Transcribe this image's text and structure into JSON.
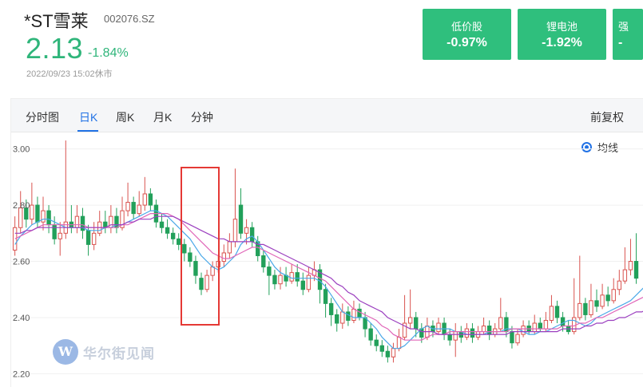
{
  "stock": {
    "name": "*ST雪莱",
    "code": "002076.SZ",
    "price": "2.13",
    "change_pct": "-1.84%",
    "timestamp": "2022/09/23 15:02休市"
  },
  "sectors": [
    {
      "name": "低价股",
      "change": "-0.97%"
    },
    {
      "name": "锂电池",
      "change": "-1.92%"
    },
    {
      "name": "强",
      "change": "-"
    }
  ],
  "tabs": [
    "分时图",
    "日K",
    "周K",
    "月K",
    "分钟"
  ],
  "active_tab": "日K",
  "adjust_label": "前复权",
  "ma_toggle_label": "均线",
  "watermark_text": "华尔街见闻",
  "watermark_logo_letter": "W",
  "colors": {
    "up": "#d9534f",
    "down": "#22a05a",
    "accent": "#2172e5",
    "card": "#2fbf7d"
  },
  "chart_data": {
    "type": "candlestick",
    "y_ticks": [
      "3.00",
      "2.80",
      "2.60",
      "2.40",
      "2.20"
    ],
    "ylim": [
      2.17,
      3.05
    ],
    "x_span": [
      0,
      130
    ],
    "candles": [
      {
        "o": 2.64,
        "c": 2.72,
        "h": 2.76,
        "l": 2.62
      },
      {
        "o": 2.72,
        "c": 2.79,
        "h": 2.85,
        "l": 2.7
      },
      {
        "o": 2.79,
        "c": 2.75,
        "h": 2.82,
        "l": 2.72
      },
      {
        "o": 2.75,
        "c": 2.8,
        "h": 2.88,
        "l": 2.73
      },
      {
        "o": 2.8,
        "c": 2.74,
        "h": 2.83,
        "l": 2.72
      },
      {
        "o": 2.74,
        "c": 2.78,
        "h": 2.83,
        "l": 2.71
      },
      {
        "o": 2.78,
        "c": 2.73,
        "h": 2.8,
        "l": 2.7
      },
      {
        "o": 2.73,
        "c": 2.68,
        "h": 2.76,
        "l": 2.66
      },
      {
        "o": 2.68,
        "c": 2.7,
        "h": 2.74,
        "l": 2.62
      },
      {
        "o": 2.7,
        "c": 2.74,
        "h": 3.03,
        "l": 2.68
      },
      {
        "o": 2.74,
        "c": 2.72,
        "h": 2.8,
        "l": 2.7
      },
      {
        "o": 2.72,
        "c": 2.76,
        "h": 2.8,
        "l": 2.7
      },
      {
        "o": 2.76,
        "c": 2.71,
        "h": 2.79,
        "l": 2.68
      },
      {
        "o": 2.71,
        "c": 2.66,
        "h": 2.73,
        "l": 2.62
      },
      {
        "o": 2.66,
        "c": 2.7,
        "h": 2.74,
        "l": 2.64
      },
      {
        "o": 2.7,
        "c": 2.74,
        "h": 2.78,
        "l": 2.69
      },
      {
        "o": 2.74,
        "c": 2.72,
        "h": 2.78,
        "l": 2.7
      },
      {
        "o": 2.72,
        "c": 2.76,
        "h": 2.8,
        "l": 2.7
      },
      {
        "o": 2.76,
        "c": 2.72,
        "h": 2.79,
        "l": 2.7
      },
      {
        "o": 2.72,
        "c": 2.78,
        "h": 2.83,
        "l": 2.71
      },
      {
        "o": 2.78,
        "c": 2.81,
        "h": 2.88,
        "l": 2.76
      },
      {
        "o": 2.81,
        "c": 2.77,
        "h": 2.83,
        "l": 2.75
      },
      {
        "o": 2.77,
        "c": 2.8,
        "h": 2.85,
        "l": 2.76
      },
      {
        "o": 2.8,
        "c": 2.84,
        "h": 2.9,
        "l": 2.78
      },
      {
        "o": 2.84,
        "c": 2.8,
        "h": 2.86,
        "l": 2.78
      },
      {
        "o": 2.8,
        "c": 2.74,
        "h": 2.82,
        "l": 2.72
      },
      {
        "o": 2.74,
        "c": 2.72,
        "h": 2.77,
        "l": 2.7
      },
      {
        "o": 2.72,
        "c": 2.7,
        "h": 2.75,
        "l": 2.68
      },
      {
        "o": 2.7,
        "c": 2.68,
        "h": 2.72,
        "l": 2.66
      },
      {
        "o": 2.68,
        "c": 2.66,
        "h": 2.7,
        "l": 2.64
      },
      {
        "o": 2.66,
        "c": 2.63,
        "h": 2.68,
        "l": 2.6
      },
      {
        "o": 2.63,
        "c": 2.6,
        "h": 2.65,
        "l": 2.58
      },
      {
        "o": 2.6,
        "c": 2.55,
        "h": 2.62,
        "l": 2.52
      },
      {
        "o": 2.54,
        "c": 2.5,
        "h": 2.56,
        "l": 2.48
      },
      {
        "o": 2.5,
        "c": 2.55,
        "h": 2.57,
        "l": 2.49
      },
      {
        "o": 2.55,
        "c": 2.58,
        "h": 2.6,
        "l": 2.53
      },
      {
        "o": 2.58,
        "c": 2.6,
        "h": 2.62,
        "l": 2.56
      },
      {
        "o": 2.6,
        "c": 2.63,
        "h": 2.66,
        "l": 2.58
      },
      {
        "o": 2.63,
        "c": 2.67,
        "h": 2.7,
        "l": 2.61
      },
      {
        "o": 2.67,
        "c": 2.75,
        "h": 2.93,
        "l": 2.65
      },
      {
        "o": 2.8,
        "c": 2.7,
        "h": 2.86,
        "l": 2.68
      },
      {
        "o": 2.7,
        "c": 2.72,
        "h": 2.75,
        "l": 2.66
      },
      {
        "o": 2.72,
        "c": 2.67,
        "h": 2.74,
        "l": 2.65
      },
      {
        "o": 2.67,
        "c": 2.62,
        "h": 2.69,
        "l": 2.6
      },
      {
        "o": 2.62,
        "c": 2.58,
        "h": 2.64,
        "l": 2.56
      },
      {
        "o": 2.58,
        "c": 2.55,
        "h": 2.6,
        "l": 2.48
      },
      {
        "o": 2.55,
        "c": 2.52,
        "h": 2.57,
        "l": 2.5
      },
      {
        "o": 2.52,
        "c": 2.55,
        "h": 2.58,
        "l": 2.5
      },
      {
        "o": 2.55,
        "c": 2.53,
        "h": 2.58,
        "l": 2.51
      },
      {
        "o": 2.53,
        "c": 2.56,
        "h": 2.59,
        "l": 2.52
      },
      {
        "o": 2.56,
        "c": 2.53,
        "h": 2.59,
        "l": 2.51
      },
      {
        "o": 2.53,
        "c": 2.5,
        "h": 2.56,
        "l": 2.48
      },
      {
        "o": 2.5,
        "c": 2.55,
        "h": 2.58,
        "l": 2.49
      },
      {
        "o": 2.55,
        "c": 2.57,
        "h": 2.6,
        "l": 2.53
      },
      {
        "o": 2.57,
        "c": 2.5,
        "h": 2.59,
        "l": 2.45
      },
      {
        "o": 2.5,
        "c": 2.45,
        "h": 2.52,
        "l": 2.4
      },
      {
        "o": 2.45,
        "c": 2.41,
        "h": 2.47,
        "l": 2.37
      },
      {
        "o": 2.41,
        "c": 2.38,
        "h": 2.43,
        "l": 2.35
      },
      {
        "o": 2.38,
        "c": 2.42,
        "h": 2.45,
        "l": 2.36
      },
      {
        "o": 2.42,
        "c": 2.39,
        "h": 2.44,
        "l": 2.37
      },
      {
        "o": 2.39,
        "c": 2.43,
        "h": 2.46,
        "l": 2.38
      },
      {
        "o": 2.43,
        "c": 2.4,
        "h": 2.45,
        "l": 2.39
      },
      {
        "o": 2.4,
        "c": 2.36,
        "h": 2.42,
        "l": 2.33
      },
      {
        "o": 2.36,
        "c": 2.32,
        "h": 2.38,
        "l": 2.3
      },
      {
        "o": 2.32,
        "c": 2.3,
        "h": 2.34,
        "l": 2.28
      },
      {
        "o": 2.3,
        "c": 2.28,
        "h": 2.32,
        "l": 2.26
      },
      {
        "o": 2.28,
        "c": 2.26,
        "h": 2.3,
        "l": 2.24
      },
      {
        "o": 2.26,
        "c": 2.29,
        "h": 2.31,
        "l": 2.24
      },
      {
        "o": 2.29,
        "c": 2.33,
        "h": 2.36,
        "l": 2.28
      },
      {
        "o": 2.33,
        "c": 2.38,
        "h": 2.48,
        "l": 2.32
      },
      {
        "o": 2.38,
        "c": 2.4,
        "h": 2.5,
        "l": 2.36
      },
      {
        "o": 2.4,
        "c": 2.36,
        "h": 2.42,
        "l": 2.33
      },
      {
        "o": 2.36,
        "c": 2.33,
        "h": 2.38,
        "l": 2.31
      },
      {
        "o": 2.33,
        "c": 2.37,
        "h": 2.4,
        "l": 2.32
      },
      {
        "o": 2.37,
        "c": 2.35,
        "h": 2.39,
        "l": 2.33
      },
      {
        "o": 2.35,
        "c": 2.38,
        "h": 2.4,
        "l": 2.34
      },
      {
        "o": 2.38,
        "c": 2.34,
        "h": 2.4,
        "l": 2.32
      },
      {
        "o": 2.34,
        "c": 2.32,
        "h": 2.36,
        "l": 2.3
      },
      {
        "o": 2.32,
        "c": 2.35,
        "h": 2.38,
        "l": 2.26
      },
      {
        "o": 2.35,
        "c": 2.33,
        "h": 2.37,
        "l": 2.31
      },
      {
        "o": 2.33,
        "c": 2.36,
        "h": 2.38,
        "l": 2.32
      },
      {
        "o": 2.36,
        "c": 2.33,
        "h": 2.38,
        "l": 2.31
      },
      {
        "o": 2.33,
        "c": 2.35,
        "h": 2.37,
        "l": 2.32
      },
      {
        "o": 2.35,
        "c": 2.37,
        "h": 2.4,
        "l": 2.34
      },
      {
        "o": 2.37,
        "c": 2.34,
        "h": 2.39,
        "l": 2.32
      },
      {
        "o": 2.34,
        "c": 2.36,
        "h": 2.38,
        "l": 2.33
      },
      {
        "o": 2.36,
        "c": 2.4,
        "h": 2.47,
        "l": 2.35
      },
      {
        "o": 2.4,
        "c": 2.35,
        "h": 2.42,
        "l": 2.33
      },
      {
        "o": 2.35,
        "c": 2.31,
        "h": 2.37,
        "l": 2.29
      },
      {
        "o": 2.31,
        "c": 2.34,
        "h": 2.36,
        "l": 2.3
      },
      {
        "o": 2.34,
        "c": 2.37,
        "h": 2.39,
        "l": 2.33
      },
      {
        "o": 2.37,
        "c": 2.35,
        "h": 2.39,
        "l": 2.34
      },
      {
        "o": 2.35,
        "c": 2.38,
        "h": 2.41,
        "l": 2.34
      },
      {
        "o": 2.38,
        "c": 2.36,
        "h": 2.4,
        "l": 2.35
      },
      {
        "o": 2.36,
        "c": 2.39,
        "h": 2.42,
        "l": 2.35
      },
      {
        "o": 2.39,
        "c": 2.44,
        "h": 2.48,
        "l": 2.38
      },
      {
        "o": 2.44,
        "c": 2.4,
        "h": 2.46,
        "l": 2.38
      },
      {
        "o": 2.4,
        "c": 2.37,
        "h": 2.42,
        "l": 2.35
      },
      {
        "o": 2.37,
        "c": 2.35,
        "h": 2.39,
        "l": 2.34
      },
      {
        "o": 2.35,
        "c": 2.4,
        "h": 2.54,
        "l": 2.34
      },
      {
        "o": 2.4,
        "c": 2.45,
        "h": 2.62,
        "l": 2.39
      },
      {
        "o": 2.45,
        "c": 2.41,
        "h": 2.47,
        "l": 2.39
      },
      {
        "o": 2.41,
        "c": 2.46,
        "h": 2.52,
        "l": 2.4
      },
      {
        "o": 2.46,
        "c": 2.44,
        "h": 2.5,
        "l": 2.42
      },
      {
        "o": 2.44,
        "c": 2.48,
        "h": 2.52,
        "l": 2.43
      },
      {
        "o": 2.48,
        "c": 2.46,
        "h": 2.51,
        "l": 2.44
      },
      {
        "o": 2.46,
        "c": 2.5,
        "h": 2.54,
        "l": 2.45
      },
      {
        "o": 2.5,
        "c": 2.53,
        "h": 2.57,
        "l": 2.48
      },
      {
        "o": 2.53,
        "c": 2.57,
        "h": 2.65,
        "l": 2.52
      },
      {
        "o": 2.57,
        "c": 2.6,
        "h": 2.68,
        "l": 2.55
      },
      {
        "o": 2.6,
        "c": 2.54,
        "h": 2.7,
        "l": 2.52
      }
    ],
    "ma_lines": [
      {
        "color": "#4aa8e8",
        "values": [
          2.66,
          2.69,
          2.71,
          2.73,
          2.74,
          2.75,
          2.75,
          2.74,
          2.73,
          2.72,
          2.72,
          2.72,
          2.72,
          2.71,
          2.71,
          2.71,
          2.72,
          2.72,
          2.73,
          2.73,
          2.74,
          2.75,
          2.76,
          2.77,
          2.78,
          2.78,
          2.77,
          2.76,
          2.74,
          2.72,
          2.7,
          2.68,
          2.65,
          2.62,
          2.6,
          2.58,
          2.57,
          2.58,
          2.6,
          2.62,
          2.66,
          2.68,
          2.69,
          2.67,
          2.64,
          2.61,
          2.58,
          2.56,
          2.55,
          2.54,
          2.54,
          2.54,
          2.54,
          2.54,
          2.53,
          2.51,
          2.48,
          2.45,
          2.42,
          2.41,
          2.4,
          2.4,
          2.4,
          2.38,
          2.36,
          2.33,
          2.31,
          2.29,
          2.29,
          2.3,
          2.32,
          2.34,
          2.36,
          2.37,
          2.36,
          2.36,
          2.36,
          2.36,
          2.35,
          2.35,
          2.34,
          2.34,
          2.34,
          2.34,
          2.35,
          2.35,
          2.35,
          2.36,
          2.36,
          2.36,
          2.35,
          2.34,
          2.34,
          2.35,
          2.35,
          2.36,
          2.37,
          2.38,
          2.39,
          2.39,
          2.38,
          2.37,
          2.38,
          2.4,
          2.41,
          2.42,
          2.43,
          2.44,
          2.45,
          2.46,
          2.48,
          2.5,
          2.52,
          2.54,
          2.55
        ]
      },
      {
        "color": "#e066b8",
        "values": [
          2.68,
          2.69,
          2.7,
          2.71,
          2.72,
          2.73,
          2.73,
          2.73,
          2.73,
          2.73,
          2.73,
          2.73,
          2.73,
          2.72,
          2.72,
          2.72,
          2.72,
          2.72,
          2.72,
          2.73,
          2.73,
          2.74,
          2.75,
          2.76,
          2.77,
          2.77,
          2.77,
          2.77,
          2.76,
          2.75,
          2.73,
          2.71,
          2.69,
          2.67,
          2.65,
          2.63,
          2.62,
          2.61,
          2.61,
          2.62,
          2.63,
          2.64,
          2.65,
          2.65,
          2.64,
          2.63,
          2.62,
          2.61,
          2.6,
          2.59,
          2.58,
          2.57,
          2.56,
          2.55,
          2.54,
          2.53,
          2.51,
          2.49,
          2.47,
          2.45,
          2.43,
          2.42,
          2.41,
          2.4,
          2.39,
          2.37,
          2.36,
          2.34,
          2.33,
          2.32,
          2.32,
          2.32,
          2.32,
          2.33,
          2.34,
          2.34,
          2.34,
          2.35,
          2.35,
          2.35,
          2.35,
          2.35,
          2.35,
          2.35,
          2.35,
          2.35,
          2.35,
          2.35,
          2.36,
          2.36,
          2.36,
          2.36,
          2.36,
          2.36,
          2.36,
          2.36,
          2.36,
          2.37,
          2.37,
          2.37,
          2.38,
          2.38,
          2.39,
          2.4,
          2.4,
          2.41,
          2.42,
          2.43,
          2.44,
          2.45,
          2.46,
          2.47,
          2.48,
          2.49,
          2.5
        ]
      },
      {
        "color": "#9b3fbf",
        "values": [
          2.7,
          2.7,
          2.71,
          2.71,
          2.72,
          2.72,
          2.72,
          2.72,
          2.72,
          2.72,
          2.72,
          2.72,
          2.72,
          2.72,
          2.72,
          2.72,
          2.72,
          2.73,
          2.73,
          2.73,
          2.74,
          2.74,
          2.75,
          2.75,
          2.75,
          2.76,
          2.76,
          2.76,
          2.76,
          2.75,
          2.74,
          2.73,
          2.72,
          2.71,
          2.7,
          2.69,
          2.68,
          2.68,
          2.67,
          2.67,
          2.67,
          2.67,
          2.67,
          2.66,
          2.66,
          2.65,
          2.64,
          2.63,
          2.62,
          2.61,
          2.6,
          2.59,
          2.58,
          2.57,
          2.56,
          2.55,
          2.54,
          2.52,
          2.51,
          2.49,
          2.48,
          2.46,
          2.45,
          2.44,
          2.43,
          2.42,
          2.4,
          2.39,
          2.38,
          2.37,
          2.36,
          2.36,
          2.35,
          2.35,
          2.35,
          2.34,
          2.34,
          2.34,
          2.34,
          2.34,
          2.34,
          2.34,
          2.34,
          2.34,
          2.34,
          2.34,
          2.34,
          2.34,
          2.35,
          2.35,
          2.35,
          2.35,
          2.35,
          2.35,
          2.35,
          2.35,
          2.35,
          2.36,
          2.36,
          2.36,
          2.36,
          2.37,
          2.37,
          2.38,
          2.38,
          2.39,
          2.39,
          2.4,
          2.4,
          2.41,
          2.42,
          2.42,
          2.43,
          2.44,
          2.45
        ]
      }
    ]
  }
}
